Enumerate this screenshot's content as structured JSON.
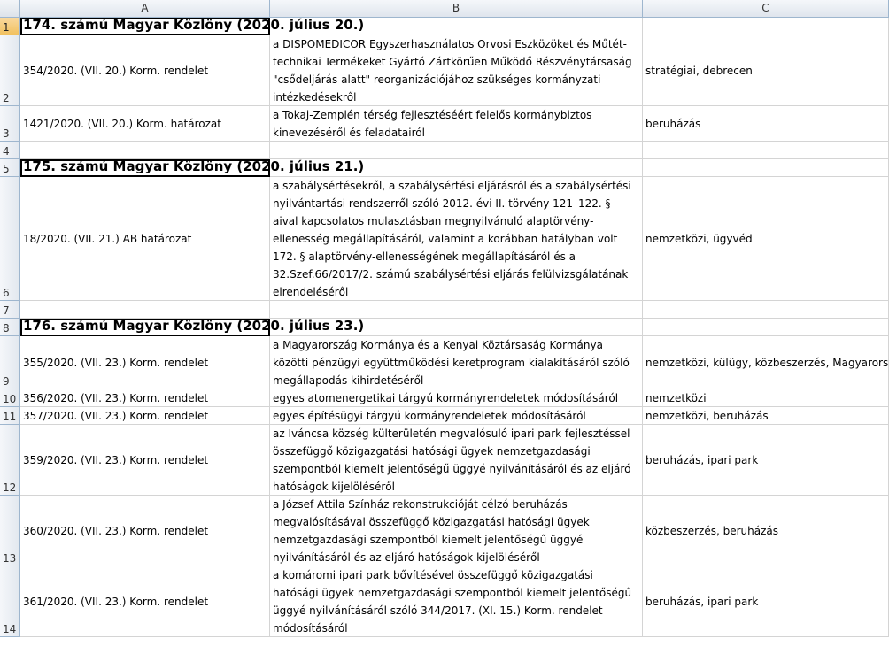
{
  "columns": [
    "A",
    "B",
    "C"
  ],
  "rows": [
    {
      "num": "1",
      "type": "title",
      "a": "174. számú Magyar Közlöny (2020. július 20.)",
      "b": "",
      "c": ""
    },
    {
      "num": "2",
      "type": "data",
      "a": "354/2020. (VII. 20.) Korm. rendelet",
      "b": "a DISPOMEDICOR Egyszerhasználatos Orvosi Eszközöket és Műtét-technikai Termékeket Gyártó Zártkörűen Működő Részvénytársaság \"csődeljárás alatt\" reorganizációjához szükséges kormányzati intézkedésekről",
      "c": "stratégiai, debrecen"
    },
    {
      "num": "3",
      "type": "data",
      "a": "1421/2020. (VII. 20.) Korm. határozat",
      "b": "a Tokaj-Zemplén térség fejlesztéséért felelős kormánybiztos kinevezéséről és feladatairól",
      "c": "beruházás"
    },
    {
      "num": "4",
      "type": "empty",
      "a": "",
      "b": "",
      "c": ""
    },
    {
      "num": "5",
      "type": "title",
      "a": "175. számú Magyar Közlöny (2020. július 21.)",
      "b": "",
      "c": ""
    },
    {
      "num": "6",
      "type": "data",
      "a": "18/2020. (VII. 21.) AB határozat",
      "b": "a szabálysértésekről, a szabálysértési eljárásról és a szabálysértési nyilvántartási rendszerről szóló 2012. évi II. törvény 121–122. §-aival kapcsolatos mulasztásban megnyilvánuló alaptörvény-ellenesség megállapításáról, valamint a korábban hatályban volt 172. § alaptörvény-ellenességének megállapításáról és a 32.Szef.66/2017/2. számú szabálysértési eljárás felülvizsgálatának elrendeléséről",
      "c": "nemzetközi, ügyvéd"
    },
    {
      "num": "7",
      "type": "empty",
      "a": "",
      "b": "",
      "c": ""
    },
    {
      "num": "8",
      "type": "title",
      "a": "176. számú Magyar Közlöny (2020. július 23.)",
      "b": "",
      "c": ""
    },
    {
      "num": "9",
      "type": "data",
      "a": "355/2020. (VII. 23.) Korm. rendelet",
      "b": "a Magyarország Kormánya és a Kenyai Köztársaság Kormánya közötti pénzügyi együttműködési keretprogram kialakításáról szóló megállapodás kihirdetéséről",
      "c": "nemzetközi, külügy, közbeszerzés, Magyarország Kormánya, külpol, külgaz"
    },
    {
      "num": "10",
      "type": "data",
      "a": "356/2020. (VII. 23.) Korm. rendelet",
      "b": "egyes atomenergetikai tárgyú kormányrendeletek módosításáról",
      "c": "nemzetközi"
    },
    {
      "num": "11",
      "type": "data",
      "a": "357/2020. (VII. 23.) Korm. rendelet",
      "b": "egyes építésügyi tárgyú kormányrendeletek módosításáról",
      "c": "nemzetközi, beruházás"
    },
    {
      "num": "12",
      "type": "data",
      "a": "359/2020. (VII. 23.) Korm. rendelet",
      "b": "az Iváncsa község külterületén megvalósuló ipari park fejlesztéssel összefüggő közigazgatási hatósági ügyek nemzetgazdasági szempontból kiemelt jelentőségű üggyé nyilvánításáról és az eljáró hatóságok kijelöléséről",
      "c": "beruházás, ipari park"
    },
    {
      "num": "13",
      "type": "data",
      "a": "360/2020. (VII. 23.) Korm. rendelet",
      "b": "a József Attila Színház rekonstrukcióját célzó beruházás megvalósításával összefüggő közigazgatási hatósági ügyek nemzetgazdasági szempontból kiemelt jelentőségű üggyé nyilvánításáról és az eljáró hatóságok kijelöléséről",
      "c": "közbeszerzés, beruházás"
    },
    {
      "num": "14",
      "type": "data",
      "a": "361/2020. (VII. 23.) Korm. rendelet",
      "b": "a komáromi ipari park bővítésével összefüggő közigazgatási hatósági ügyek nemzetgazdasági szempontból kiemelt jelentőségű üggyé nyilvánításáról szóló 344/2017. (XI. 15.) Korm. rendelet módosításáról",
      "c": "beruházás, ipari park"
    }
  ]
}
